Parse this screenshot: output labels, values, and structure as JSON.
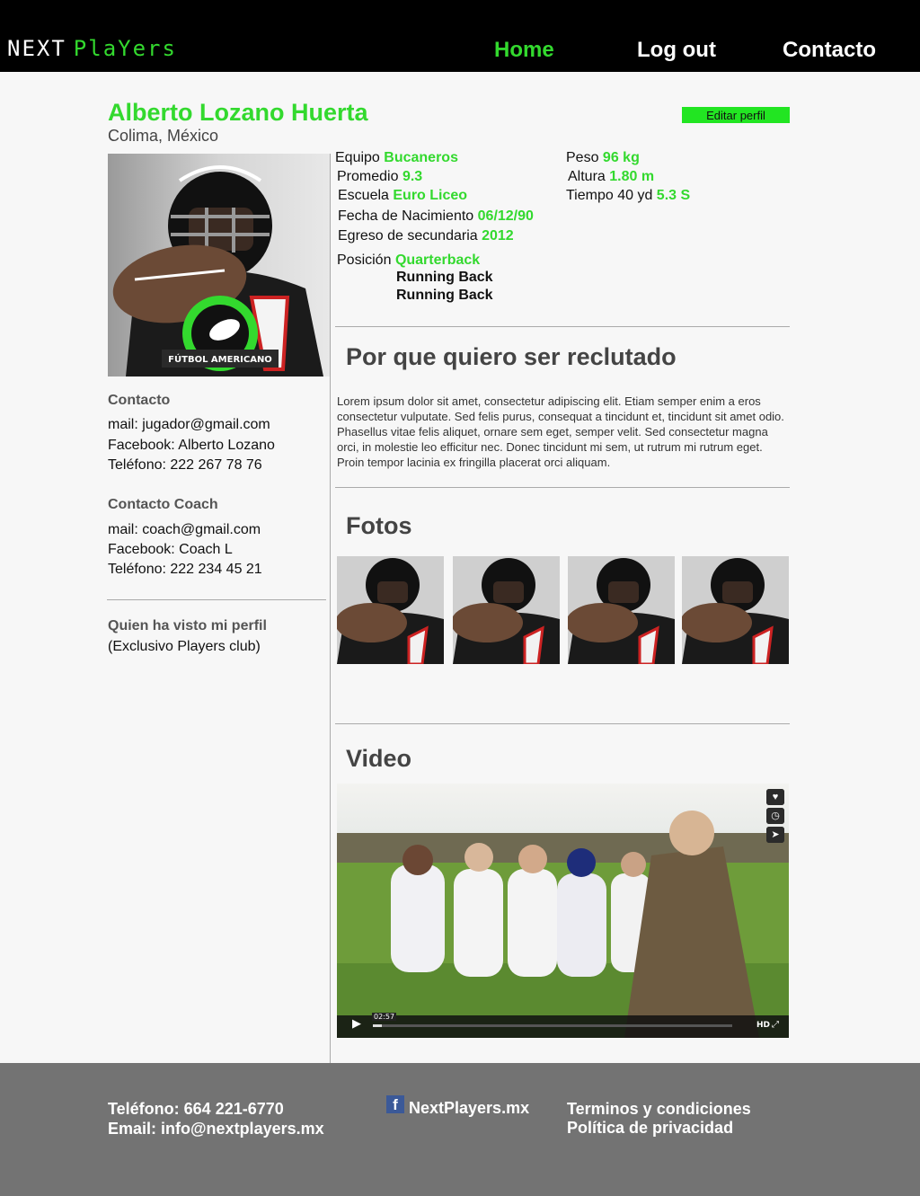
{
  "header": {
    "logo_part1": "NEXT",
    "logo_part2": "PlaYers",
    "nav": {
      "home": "Home",
      "logout": "Log out",
      "contacto": "Contacto"
    }
  },
  "profile": {
    "name": "Alberto Lozano Huerta",
    "location": "Colima, México",
    "edit_button": "Editar perfil",
    "photo_badge": "FÚTBOL AMERICANO"
  },
  "stats": {
    "equipo_label": "Equipo",
    "equipo_value": "Bucaneros",
    "promedio_label": "Promedio",
    "promedio_value": "9.3",
    "escuela_label": "Escuela",
    "escuela_value": "Euro Liceo",
    "nacimiento_label": "Fecha de Nacimiento",
    "nacimiento_value": "06/12/90",
    "egreso_label": "Egreso de secundaria",
    "egreso_value": "2012",
    "posicion_label": "Posición",
    "posiciones": [
      "Quarterback",
      "Running Back",
      "Running Back"
    ],
    "peso_label": "Peso",
    "peso_value": "96 kg",
    "altura_label": "Altura",
    "altura_value": "1.80 m",
    "tiempo_label": "Tiempo 40 yd",
    "tiempo_value": "5.3 S"
  },
  "contact": {
    "title": "Contacto",
    "mail": "mail: jugador@gmail.com",
    "facebook": "Facebook: Alberto Lozano",
    "telefono": "Teléfono: 222 267 78 76"
  },
  "coach": {
    "title": "Contacto Coach",
    "mail": "mail: coach@gmail.com",
    "facebook": "Facebook: Coach L",
    "telefono": "Teléfono: 222 234 45 21"
  },
  "visits": {
    "title": "Quien ha visto mi perfil",
    "note": "(Exclusivo Players club)"
  },
  "why": {
    "title": "Por que quiero ser reclutado",
    "text": "Lorem ipsum dolor sit amet, consectetur adipiscing elit. Etiam semper enim a eros consectetur vulputate. Sed felis purus, consequat a tincidunt et, tincidunt sit amet odio. Phasellus vitae felis aliquet, ornare sem eget, semper velit. Sed consectetur magna orci, in molestie leo efficitur nec. Donec tincidunt mi sem, ut rutrum mi rutrum eget. Proin tempor lacinia ex fringilla placerat orci aliquam."
  },
  "photos": {
    "title": "Fotos"
  },
  "video": {
    "title": "Video",
    "time": "02:57",
    "hd": "HD"
  },
  "footer": {
    "telefono": "Teléfono: 664 221-6770",
    "email": "Email: info@nextplayers.mx",
    "facebook": "NextPlayers.mx",
    "terminos": "Terminos y condiciones",
    "privacidad": "Política de privacidad"
  },
  "colors": {
    "accent": "#33d92e",
    "header_bg": "#000000",
    "footer_bg": "#737373"
  }
}
